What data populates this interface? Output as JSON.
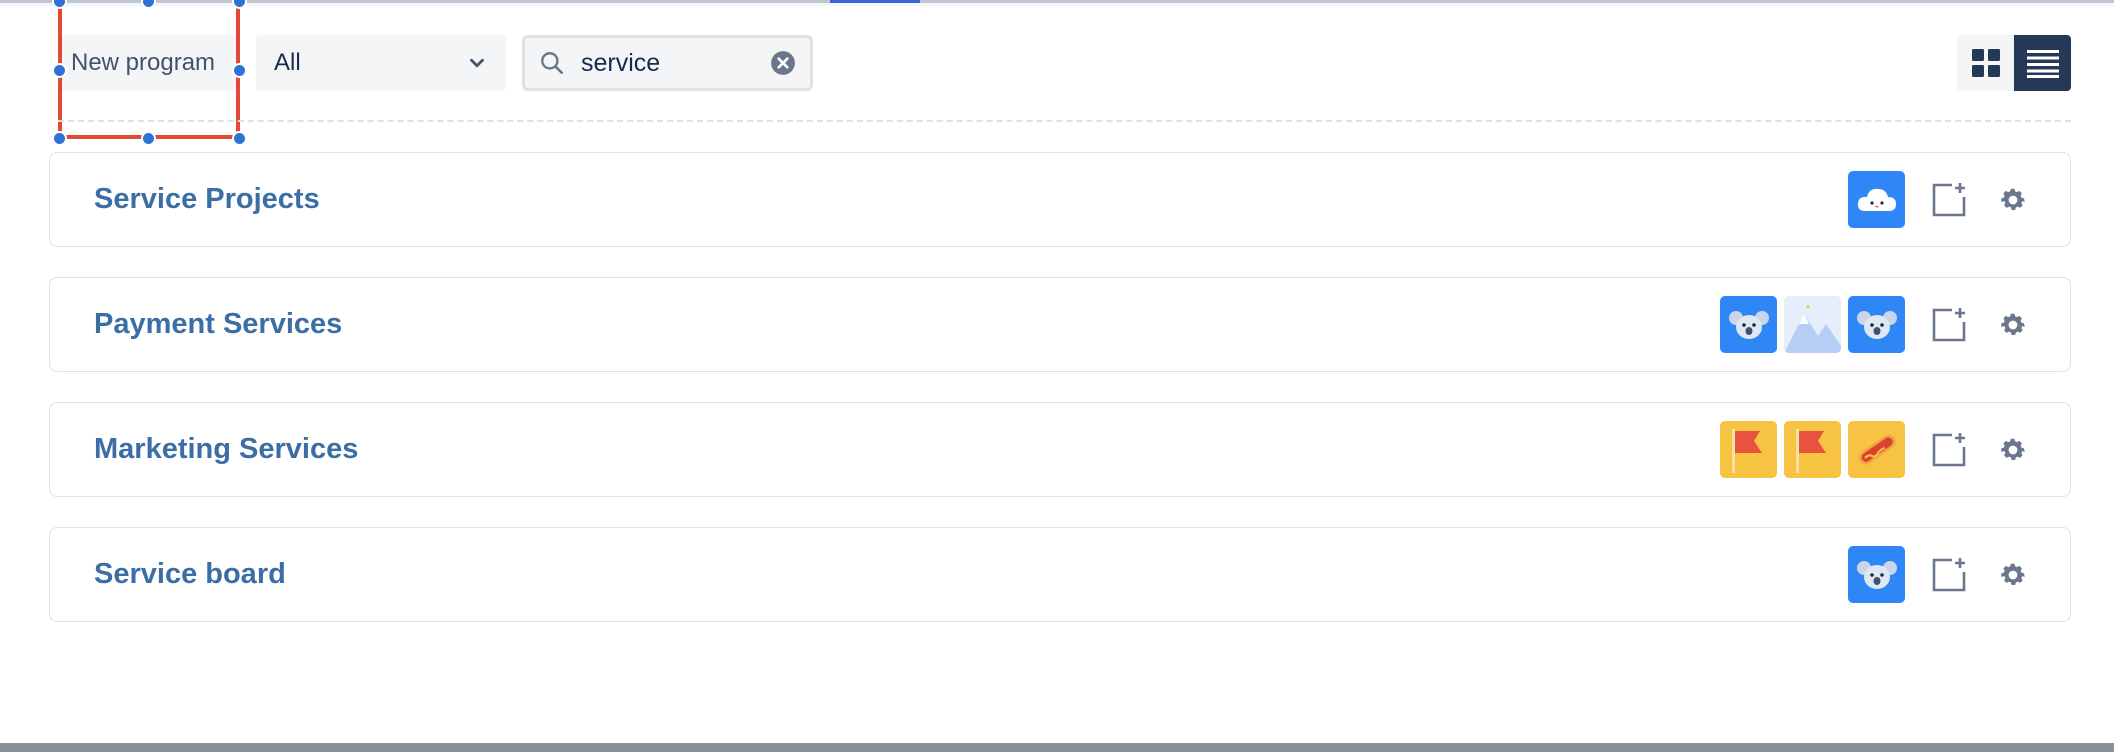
{
  "toolbar": {
    "new_program_label": "New program",
    "filter": {
      "selected": "All"
    },
    "search": {
      "value": "service"
    },
    "view_modes": [
      "grid",
      "list"
    ],
    "active_view": "list"
  },
  "programs": [
    {
      "name": "Service Projects",
      "avatars": [
        "cloud-avatar"
      ]
    },
    {
      "name": "Payment Services",
      "avatars": [
        "koala-avatar",
        "mountain-avatar",
        "koala-avatar"
      ]
    },
    {
      "name": "Marketing Services",
      "avatars": [
        "flag-avatar",
        "flag-avatar",
        "hotdog-avatar"
      ]
    },
    {
      "name": "Service board",
      "avatars": [
        "koala-avatar"
      ]
    }
  ],
  "colors": {
    "accent_blue": "#2f86f6",
    "title_blue": "#3a6ea5",
    "selection_red": "#e34935",
    "handle_blue": "#2f72d6",
    "active_toggle": "#253858"
  },
  "icons": [
    "search-icon",
    "clear-icon",
    "chevron-down-icon",
    "grid-view-icon",
    "list-view-icon",
    "add-board-icon",
    "gear-icon"
  ]
}
